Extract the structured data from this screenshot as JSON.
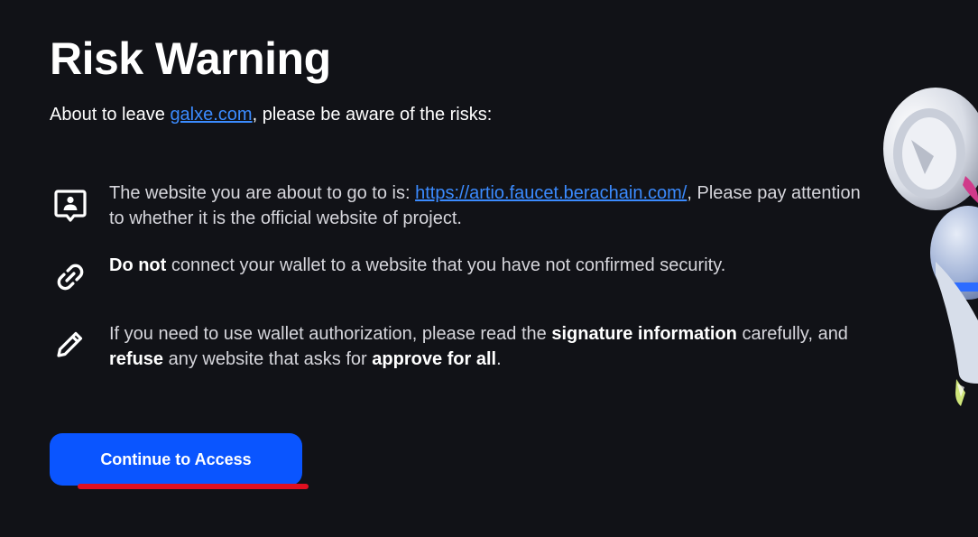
{
  "title": "Risk Warning",
  "subtitle": {
    "prefix": "About to leave ",
    "link": "galxe.com",
    "suffix": ", please be aware of the risks:"
  },
  "risks": [
    {
      "icon": "user-badge-icon",
      "text_before": "The website you are about to go to is: ",
      "link": "https://artio.faucet.berachain.com/",
      "text_after": ", Please pay attention to whether it is the official website of project."
    },
    {
      "icon": "link-icon",
      "bold_1": "Do not",
      "text_1": " connect your wallet to a website that you have not confirmed security."
    },
    {
      "icon": "pencil-icon",
      "text_1": "If you need to use wallet authorization, please read the ",
      "bold_1": "signature information",
      "text_2": " carefully, and ",
      "bold_2": "refuse",
      "text_3": " any website that asks for ",
      "bold_3": "approve for all",
      "text_4": "."
    }
  ],
  "button": {
    "label": "Continue to Access"
  },
  "colors": {
    "background": "#111217",
    "accent": "#0a55ff",
    "link": "#3b8bff",
    "annotation": "#e01020"
  }
}
